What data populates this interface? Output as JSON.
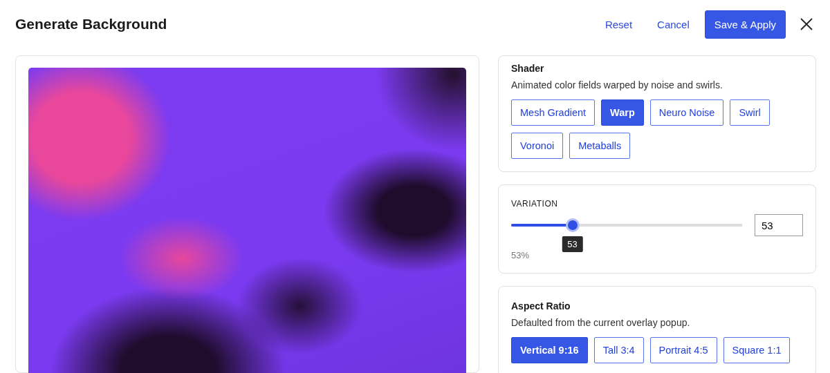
{
  "header": {
    "title": "Generate Background",
    "actions": [
      {
        "label": "Reset",
        "kind": "link"
      },
      {
        "label": "Cancel",
        "kind": "link"
      },
      {
        "label": "Save & Apply",
        "kind": "primary"
      }
    ]
  },
  "shader": {
    "title": "Shader",
    "description": "Animated color fields warped by noise and swirls.",
    "options": [
      {
        "label": "Mesh Gradient",
        "selected": false
      },
      {
        "label": "Warp",
        "selected": true
      },
      {
        "label": "Neuro Noise",
        "selected": false
      },
      {
        "label": "Swirl",
        "selected": false
      },
      {
        "label": "Voronoi",
        "selected": false
      },
      {
        "label": "Metaballs",
        "selected": false
      }
    ]
  },
  "variation": {
    "label": "VARIATION",
    "level": 0.265,
    "tooltip": "53",
    "reading": "53%",
    "value": "53"
  },
  "aspect_ratio": {
    "title": "Aspect Ratio",
    "description": "Defaulted from the current overlay popup.",
    "options": [
      {
        "label": "Vertical 9:16",
        "selected": true
      },
      {
        "label": "Tall 3:4",
        "selected": false
      },
      {
        "label": "Portrait 4:5",
        "selected": false
      },
      {
        "label": "Square 1:1",
        "selected": false
      }
    ]
  }
}
